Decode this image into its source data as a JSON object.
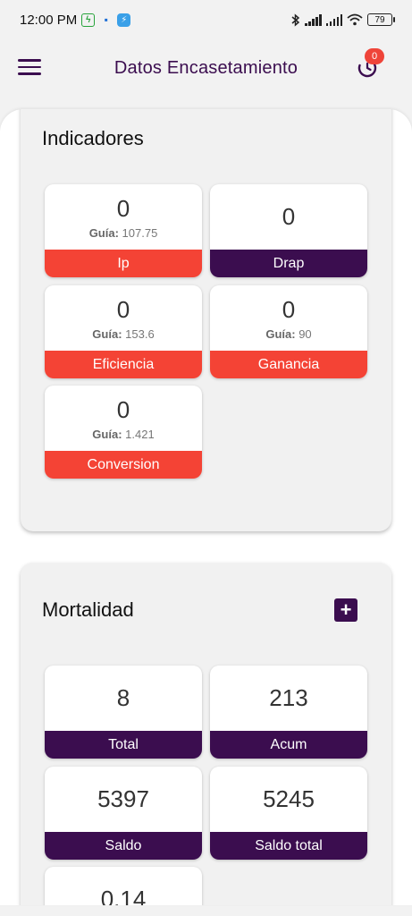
{
  "status_bar": {
    "time": "12:00 PM",
    "battery": "79"
  },
  "app_bar": {
    "title": "Datos Encasetamiento",
    "notification_count": "0"
  },
  "indicadores": {
    "title": "Indicadores",
    "guide_label": "Guía:",
    "tiles": [
      {
        "value": "0",
        "guide": "107.75",
        "label": "Ip",
        "color": "#f44335"
      },
      {
        "value": "0",
        "guide": "",
        "label": "Drap",
        "color": "#3b0d4f"
      },
      {
        "value": "0",
        "guide": "153.6",
        "label": "Eficiencia",
        "color": "#f44335"
      },
      {
        "value": "0",
        "guide": "90",
        "label": "Ganancia",
        "color": "#f44335"
      },
      {
        "value": "0",
        "guide": "1.421",
        "label": "Conversion",
        "color": "#f44335"
      }
    ]
  },
  "mortalidad": {
    "title": "Mortalidad",
    "add_label": "+",
    "tiles": [
      {
        "value": "8",
        "label": "Total",
        "color": "#3b0d4f"
      },
      {
        "value": "213",
        "label": "Acum",
        "color": "#3b0d4f"
      },
      {
        "value": "5397",
        "label": "Saldo",
        "color": "#3b0d4f"
      },
      {
        "value": "5245",
        "label": "Saldo total",
        "color": "#3b0d4f"
      },
      {
        "value": "0.14",
        "label": "",
        "color": "#3b0d4f"
      }
    ]
  },
  "colors": {
    "primary": "#3b0d4f",
    "accent_red": "#f44335"
  }
}
